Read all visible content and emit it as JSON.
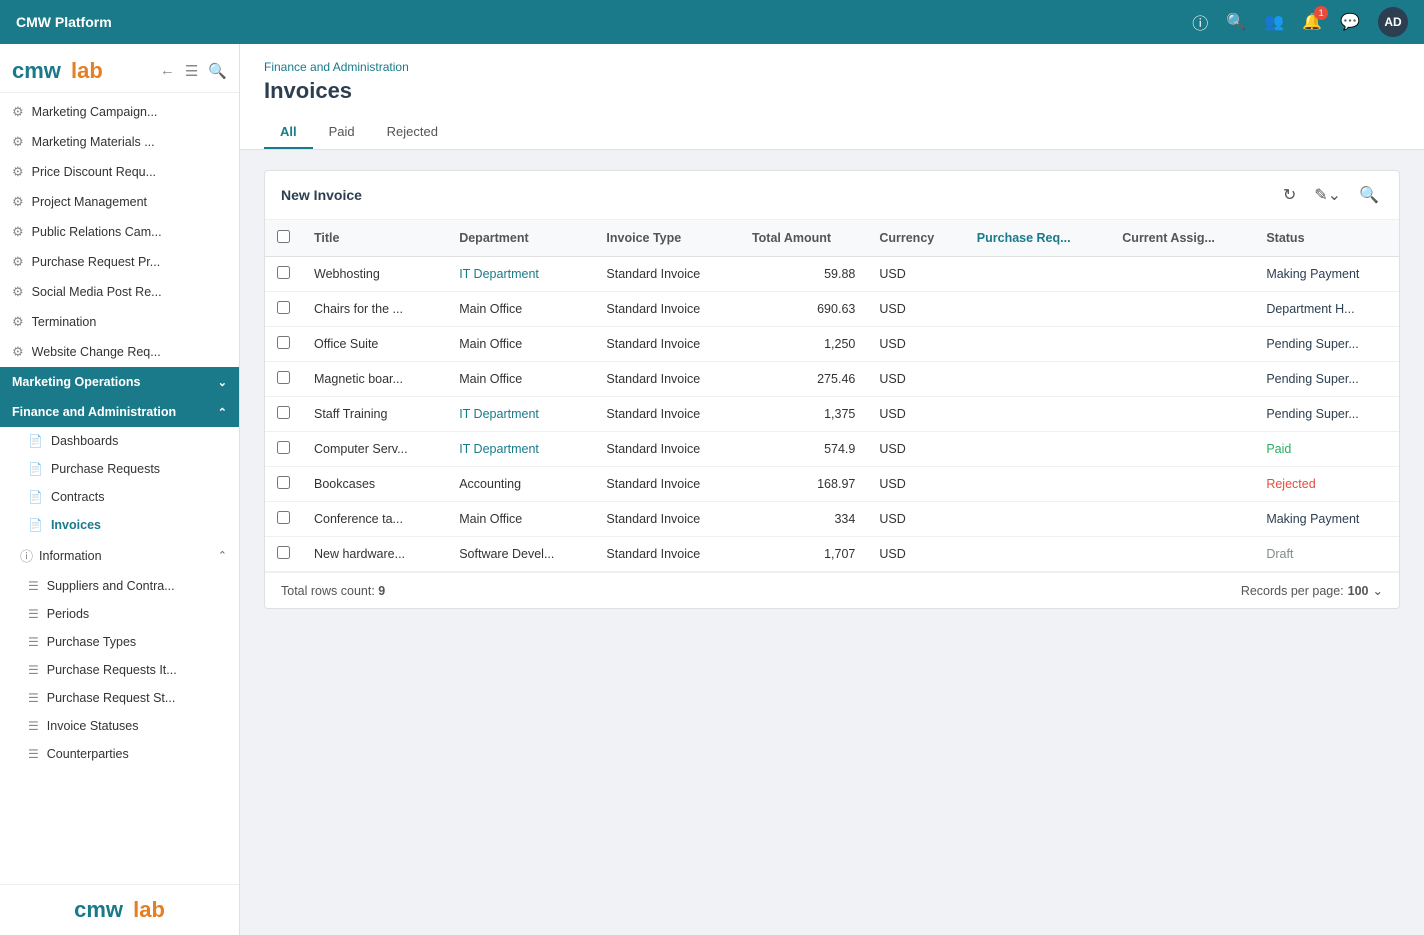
{
  "app": {
    "name": "CMW Platform",
    "logo_cmw": "cmw",
    "logo_lab": "lab"
  },
  "topnav": {
    "title": "CMW Platform",
    "icons": [
      "help",
      "search",
      "users",
      "bell",
      "message"
    ],
    "notification_count": "1",
    "avatar_initials": "AD"
  },
  "sidebar": {
    "items": [
      {
        "id": "marketing-campaign",
        "label": "Marketing Campaign...",
        "icon": "⚙"
      },
      {
        "id": "marketing-materials",
        "label": "Marketing Materials ...",
        "icon": "⚙"
      },
      {
        "id": "price-discount",
        "label": "Price Discount Requ...",
        "icon": "⚙"
      },
      {
        "id": "project-management",
        "label": "Project Management",
        "icon": "⚙"
      },
      {
        "id": "public-relations",
        "label": "Public Relations Cam...",
        "icon": "⚙"
      },
      {
        "id": "purchase-request-pr",
        "label": "Purchase Request Pr...",
        "icon": "⚙"
      },
      {
        "id": "social-media",
        "label": "Social Media Post Re...",
        "icon": "⚙"
      },
      {
        "id": "termination",
        "label": "Termination",
        "icon": "⚙"
      },
      {
        "id": "website-change",
        "label": "Website Change Req...",
        "icon": "⚙"
      }
    ],
    "marketing_operations": {
      "label": "Marketing Operations",
      "active": true
    },
    "finance_admin": {
      "label": "Finance and Administration",
      "active": true,
      "sub_items": [
        {
          "id": "dashboards",
          "label": "Dashboards",
          "icon": "📄"
        },
        {
          "id": "purchase-requests",
          "label": "Purchase Requests",
          "icon": "📄"
        },
        {
          "id": "contracts",
          "label": "Contracts",
          "icon": "📄"
        },
        {
          "id": "invoices",
          "label": "Invoices",
          "icon": "📄",
          "active": true
        }
      ]
    },
    "information": {
      "label": "Information",
      "sub_items": [
        {
          "id": "suppliers-contracts",
          "label": "Suppliers and Contra...",
          "icon": "≡"
        },
        {
          "id": "periods",
          "label": "Periods",
          "icon": "≡"
        },
        {
          "id": "purchase-types",
          "label": "Purchase Types",
          "icon": "≡"
        },
        {
          "id": "purchase-requests-it",
          "label": "Purchase Requests It...",
          "icon": "≡"
        },
        {
          "id": "purchase-request-st",
          "label": "Purchase Request St...",
          "icon": "≡"
        },
        {
          "id": "invoice-statuses",
          "label": "Invoice Statuses",
          "icon": "≡"
        },
        {
          "id": "counterparties",
          "label": "Counterparties",
          "icon": "≡"
        }
      ]
    },
    "footer_logo_cmw": "cmw",
    "footer_logo_lab": "lab"
  },
  "breadcrumb": "Finance and Administration",
  "page_title": "Invoices",
  "tabs": [
    {
      "id": "all",
      "label": "All",
      "active": true
    },
    {
      "id": "paid",
      "label": "Paid",
      "active": false
    },
    {
      "id": "rejected",
      "label": "Rejected",
      "active": false
    }
  ],
  "toolbar": {
    "new_invoice_label": "New Invoice"
  },
  "table": {
    "columns": [
      {
        "id": "check",
        "label": ""
      },
      {
        "id": "title",
        "label": "Title"
      },
      {
        "id": "department",
        "label": "Department"
      },
      {
        "id": "invoice_type",
        "label": "Invoice Type"
      },
      {
        "id": "total_amount",
        "label": "Total Amount"
      },
      {
        "id": "currency",
        "label": "Currency"
      },
      {
        "id": "purchase_req",
        "label": "Purchase Req..."
      },
      {
        "id": "current_assign",
        "label": "Current Assig..."
      },
      {
        "id": "status",
        "label": "Status"
      }
    ],
    "rows": [
      {
        "title": "Webhosting",
        "department": "IT Department",
        "dept_class": "dept-it",
        "invoice_type": "Standard Invoice",
        "total_amount": "59.88",
        "currency": "USD",
        "purchase_req": "",
        "current_assign": "",
        "status": "Making Payment",
        "status_class": "status-making"
      },
      {
        "title": "Chairs for the ...",
        "department": "Main Office",
        "dept_class": "",
        "invoice_type": "Standard Invoice",
        "total_amount": "690.63",
        "currency": "USD",
        "purchase_req": "",
        "current_assign": "",
        "status": "Department H...",
        "status_class": "status-dept"
      },
      {
        "title": "Office Suite",
        "department": "Main Office",
        "dept_class": "",
        "invoice_type": "Standard Invoice",
        "total_amount": "1,250",
        "currency": "USD",
        "purchase_req": "",
        "current_assign": "",
        "status": "Pending Super...",
        "status_class": "status-pending"
      },
      {
        "title": "Magnetic boar...",
        "department": "Main Office",
        "dept_class": "",
        "invoice_type": "Standard Invoice",
        "total_amount": "275.46",
        "currency": "USD",
        "purchase_req": "",
        "current_assign": "",
        "status": "Pending Super...",
        "status_class": "status-pending"
      },
      {
        "title": "Staff Training",
        "department": "IT Department",
        "dept_class": "dept-it",
        "invoice_type": "Standard Invoice",
        "total_amount": "1,375",
        "currency": "USD",
        "purchase_req": "",
        "current_assign": "",
        "status": "Pending Super...",
        "status_class": "status-pending"
      },
      {
        "title": "Computer Serv...",
        "department": "IT Department",
        "dept_class": "dept-it",
        "invoice_type": "Standard Invoice",
        "total_amount": "574.9",
        "currency": "USD",
        "purchase_req": "",
        "current_assign": "",
        "status": "Paid",
        "status_class": "status-paid"
      },
      {
        "title": "Bookcases",
        "department": "Accounting",
        "dept_class": "",
        "invoice_type": "Standard Invoice",
        "total_amount": "168.97",
        "currency": "USD",
        "purchase_req": "",
        "current_assign": "",
        "status": "Rejected",
        "status_class": "status-rejected"
      },
      {
        "title": "Conference ta...",
        "department": "Main Office",
        "dept_class": "",
        "invoice_type": "Standard Invoice",
        "total_amount": "334",
        "currency": "USD",
        "purchase_req": "",
        "current_assign": "",
        "status": "Making Payment",
        "status_class": "status-making"
      },
      {
        "title": "New hardware...",
        "department": "Software Devel...",
        "dept_class": "",
        "invoice_type": "Standard Invoice",
        "total_amount": "1,707",
        "currency": "USD",
        "purchase_req": "",
        "current_assign": "",
        "status": "Draft",
        "status_class": "status-draft"
      }
    ],
    "footer": {
      "total_rows_label": "Total rows count:",
      "total_rows_value": "9",
      "records_per_page_label": "Records per page:",
      "records_per_page_value": "100"
    }
  }
}
